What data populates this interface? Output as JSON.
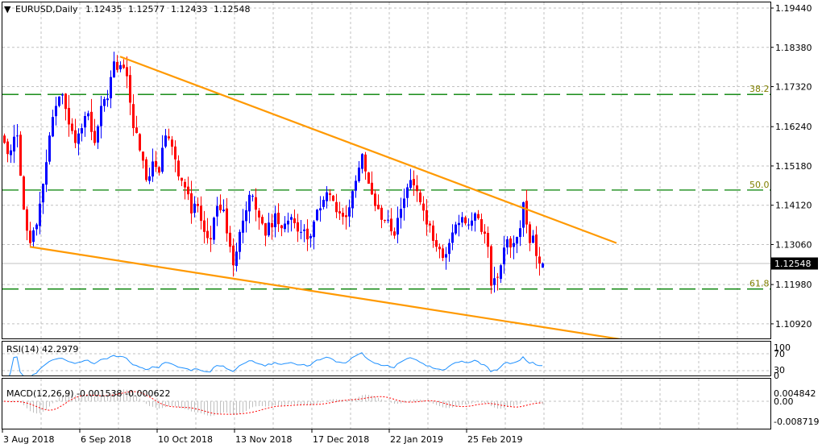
{
  "header": {
    "symbol": "EURUSD,Daily",
    "open": "1.12435",
    "high": "1.12577",
    "low": "1.12433",
    "close": "1.12548"
  },
  "price_axis": [
    "1.19440",
    "1.18380",
    "1.17320",
    "1.16240",
    "1.15180",
    "1.14120",
    "1.13060",
    "1.11980",
    "1.10920"
  ],
  "current_price": "1.12548",
  "fib_levels": [
    {
      "label": "38.2",
      "price": 1.1711
    },
    {
      "label": "50.0",
      "price": 1.1453
    },
    {
      "label": "61.8",
      "price": 1.1186
    }
  ],
  "rsi": {
    "label": "RSI(14) 42.2979",
    "axis": [
      "100",
      "70",
      "30",
      "0"
    ]
  },
  "macd": {
    "label": "MACD(12,26,9) -0.001538 -0.000622",
    "axis": [
      "0.004842",
      "0.00",
      "-0.008719"
    ]
  },
  "time_axis": [
    "3 Aug 2018",
    "6 Sep 2018",
    "10 Oct 2018",
    "13 Nov 2018",
    "17 Dec 2018",
    "22 Jan 2019",
    "25 Feb 2019"
  ],
  "colors": {
    "bull": "#0000ff",
    "bear": "#ff0000",
    "trendline": "#ff9900",
    "fib": "#008000",
    "rsi": "#1e90ff",
    "macd_hist": "#c0c0c0",
    "macd_signal": "#ff0000",
    "grid": "#c0c0c0"
  },
  "chart_data": {
    "type": "candlestick",
    "title": "EURUSD,Daily",
    "ylim": [
      1.1048,
      1.196
    ],
    "bars": 168,
    "last_bar": {
      "open": 1.12435,
      "high": 1.12577,
      "low": 1.12433,
      "close": 1.12548
    },
    "close_path": [
      [
        0,
        1.158
      ],
      [
        2,
        1.156
      ],
      [
        4,
        1.16
      ],
      [
        6,
        1.14
      ],
      [
        8,
        1.131
      ],
      [
        10,
        1.136
      ],
      [
        12,
        1.147
      ],
      [
        14,
        1.16
      ],
      [
        16,
        1.168
      ],
      [
        18,
        1.171
      ],
      [
        20,
        1.163
      ],
      [
        22,
        1.158
      ],
      [
        24,
        1.162
      ],
      [
        26,
        1.166
      ],
      [
        28,
        1.158
      ],
      [
        30,
        1.168
      ],
      [
        32,
        1.17
      ],
      [
        34,
        1.18
      ],
      [
        36,
        1.179
      ],
      [
        38,
        1.176
      ],
      [
        40,
        1.162
      ],
      [
        42,
        1.156
      ],
      [
        44,
        1.148
      ],
      [
        46,
        1.153
      ],
      [
        48,
        1.15
      ],
      [
        50,
        1.16
      ],
      [
        52,
        1.157
      ],
      [
        54,
        1.149
      ],
      [
        56,
        1.146
      ],
      [
        58,
        1.139
      ],
      [
        60,
        1.141
      ],
      [
        62,
        1.134
      ],
      [
        64,
        1.132
      ],
      [
        66,
        1.141
      ],
      [
        68,
        1.14
      ],
      [
        70,
        1.13
      ],
      [
        71,
        1.125
      ],
      [
        73,
        1.134
      ],
      [
        76,
        1.144
      ],
      [
        78,
        1.14
      ],
      [
        81,
        1.133
      ],
      [
        84,
        1.139
      ],
      [
        86,
        1.135
      ],
      [
        89,
        1.138
      ],
      [
        92,
        1.134
      ],
      [
        94,
        1.132
      ],
      [
        97,
        1.14
      ],
      [
        101,
        1.144
      ],
      [
        104,
        1.139
      ],
      [
        106,
        1.138
      ],
      [
        108,
        1.145
      ],
      [
        111,
        1.155
      ],
      [
        113,
        1.147
      ],
      [
        115,
        1.141
      ],
      [
        118,
        1.137
      ],
      [
        121,
        1.133
      ],
      [
        124,
        1.143
      ],
      [
        126,
        1.148
      ],
      [
        128,
        1.145
      ],
      [
        131,
        1.136
      ],
      [
        134,
        1.13
      ],
      [
        136,
        1.127
      ],
      [
        138,
        1.131
      ],
      [
        140,
        1.136
      ],
      [
        142,
        1.138
      ],
      [
        144,
        1.136
      ],
      [
        146,
        1.139
      ],
      [
        148,
        1.134
      ],
      [
        150,
        1.13
      ],
      [
        151,
        1.1195
      ],
      [
        152,
        1.1215
      ],
      [
        154,
        1.125
      ],
      [
        156,
        1.132
      ],
      [
        158,
        1.131
      ],
      [
        160,
        1.135
      ],
      [
        161,
        1.142
      ],
      [
        162,
        1.136
      ],
      [
        163,
        1.131
      ],
      [
        164,
        1.133
      ],
      [
        165,
        1.1275
      ],
      [
        166,
        1.1255
      ],
      [
        167,
        1.12548
      ]
    ],
    "trendlines": [
      {
        "name": "upper",
        "from": [
          36,
          1.1813
        ],
        "to": [
          190,
          1.131
        ]
      },
      {
        "name": "lower",
        "from": [
          8,
          1.13
        ],
        "to": [
          193,
          1.1048
        ]
      }
    ],
    "indicators": {
      "rsi": {
        "period": 14,
        "value": 42.2979,
        "levels": [
          30,
          70
        ],
        "ylim": [
          0,
          100
        ]
      },
      "macd": {
        "fast": 12,
        "slow": 26,
        "signal": 9,
        "main": -0.001538,
        "signal_value": -0.000622,
        "ylim": [
          -0.008719,
          0.004842
        ]
      }
    }
  }
}
